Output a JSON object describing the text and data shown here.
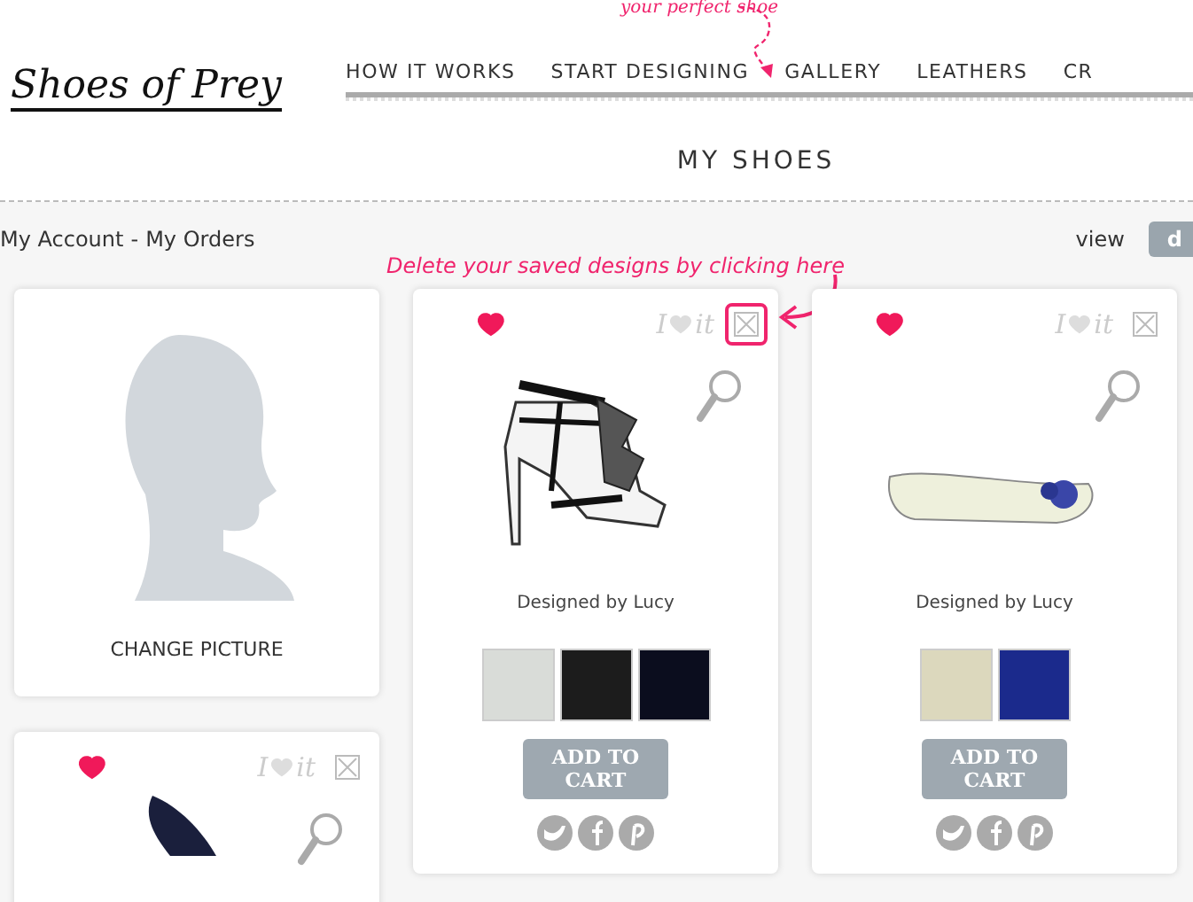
{
  "header": {
    "logo": "Shoes of Prey",
    "nav": [
      "HOW IT WORKS",
      "START DESIGNING",
      "GALLERY",
      "LEATHERS",
      "CR"
    ],
    "nav_note": "your perfect shoe",
    "title": "MY SHOES"
  },
  "account_links": [
    "My Account",
    "My Orders"
  ],
  "link_separator": "-",
  "view": {
    "label": "view",
    "button": "d"
  },
  "callout": "Delete your saved designs by clicking here",
  "columns": [
    {
      "cards": [
        {
          "kind": "profile",
          "link": "CHANGE PICTURE"
        },
        {
          "kind": "design",
          "favorite": true,
          "like": [
            "I",
            "it"
          ],
          "highlighted": false,
          "shoe": {
            "kind": "pump"
          }
        }
      ]
    },
    {
      "cards": [
        {
          "kind": "design",
          "favorite": true,
          "like": [
            "I",
            "it"
          ],
          "highlighted": true,
          "shoe": {
            "kind": "heel"
          },
          "designed_by": "Designed by",
          "designer": "Lucy",
          "swatches": [
            {
              "color": "#d9dcd8"
            },
            {
              "color": "#1c1c1c"
            },
            {
              "color": "#0b0d1e"
            }
          ],
          "button": [
            "ADD TO",
            "CART"
          ]
        }
      ]
    },
    {
      "cards": [
        {
          "kind": "design",
          "favorite": true,
          "like": [
            "I",
            "it"
          ],
          "highlighted": false,
          "shoe": {
            "kind": "flat"
          },
          "designed_by": "Designed by",
          "designer": "Lucy",
          "swatches": [
            {
              "color": "#dcd8bd"
            },
            {
              "color": "#1b2a8c"
            }
          ],
          "button": [
            "ADD TO",
            "CART"
          ]
        }
      ]
    }
  ]
}
